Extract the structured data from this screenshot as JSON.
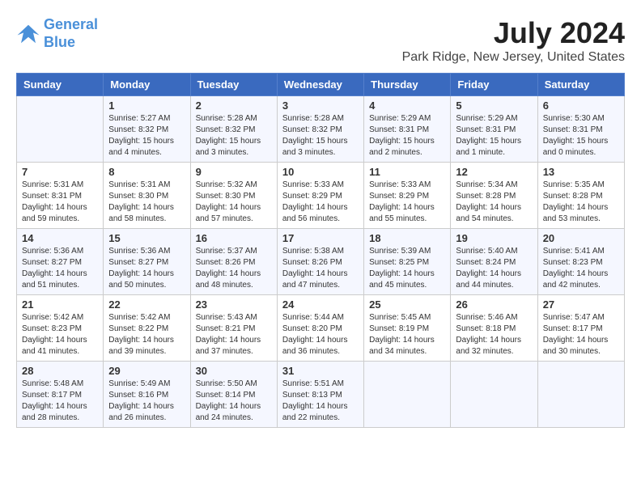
{
  "header": {
    "logo_line1": "General",
    "logo_line2": "Blue",
    "month_year": "July 2024",
    "location": "Park Ridge, New Jersey, United States"
  },
  "days_of_week": [
    "Sunday",
    "Monday",
    "Tuesday",
    "Wednesday",
    "Thursday",
    "Friday",
    "Saturday"
  ],
  "weeks": [
    [
      {
        "day": "",
        "sunrise": "",
        "sunset": "",
        "daylight": ""
      },
      {
        "day": "1",
        "sunrise": "Sunrise: 5:27 AM",
        "sunset": "Sunset: 8:32 PM",
        "daylight": "Daylight: 15 hours and 4 minutes."
      },
      {
        "day": "2",
        "sunrise": "Sunrise: 5:28 AM",
        "sunset": "Sunset: 8:32 PM",
        "daylight": "Daylight: 15 hours and 3 minutes."
      },
      {
        "day": "3",
        "sunrise": "Sunrise: 5:28 AM",
        "sunset": "Sunset: 8:32 PM",
        "daylight": "Daylight: 15 hours and 3 minutes."
      },
      {
        "day": "4",
        "sunrise": "Sunrise: 5:29 AM",
        "sunset": "Sunset: 8:31 PM",
        "daylight": "Daylight: 15 hours and 2 minutes."
      },
      {
        "day": "5",
        "sunrise": "Sunrise: 5:29 AM",
        "sunset": "Sunset: 8:31 PM",
        "daylight": "Daylight: 15 hours and 1 minute."
      },
      {
        "day": "6",
        "sunrise": "Sunrise: 5:30 AM",
        "sunset": "Sunset: 8:31 PM",
        "daylight": "Daylight: 15 hours and 0 minutes."
      }
    ],
    [
      {
        "day": "7",
        "sunrise": "Sunrise: 5:31 AM",
        "sunset": "Sunset: 8:31 PM",
        "daylight": "Daylight: 14 hours and 59 minutes."
      },
      {
        "day": "8",
        "sunrise": "Sunrise: 5:31 AM",
        "sunset": "Sunset: 8:30 PM",
        "daylight": "Daylight: 14 hours and 58 minutes."
      },
      {
        "day": "9",
        "sunrise": "Sunrise: 5:32 AM",
        "sunset": "Sunset: 8:30 PM",
        "daylight": "Daylight: 14 hours and 57 minutes."
      },
      {
        "day": "10",
        "sunrise": "Sunrise: 5:33 AM",
        "sunset": "Sunset: 8:29 PM",
        "daylight": "Daylight: 14 hours and 56 minutes."
      },
      {
        "day": "11",
        "sunrise": "Sunrise: 5:33 AM",
        "sunset": "Sunset: 8:29 PM",
        "daylight": "Daylight: 14 hours and 55 minutes."
      },
      {
        "day": "12",
        "sunrise": "Sunrise: 5:34 AM",
        "sunset": "Sunset: 8:28 PM",
        "daylight": "Daylight: 14 hours and 54 minutes."
      },
      {
        "day": "13",
        "sunrise": "Sunrise: 5:35 AM",
        "sunset": "Sunset: 8:28 PM",
        "daylight": "Daylight: 14 hours and 53 minutes."
      }
    ],
    [
      {
        "day": "14",
        "sunrise": "Sunrise: 5:36 AM",
        "sunset": "Sunset: 8:27 PM",
        "daylight": "Daylight: 14 hours and 51 minutes."
      },
      {
        "day": "15",
        "sunrise": "Sunrise: 5:36 AM",
        "sunset": "Sunset: 8:27 PM",
        "daylight": "Daylight: 14 hours and 50 minutes."
      },
      {
        "day": "16",
        "sunrise": "Sunrise: 5:37 AM",
        "sunset": "Sunset: 8:26 PM",
        "daylight": "Daylight: 14 hours and 48 minutes."
      },
      {
        "day": "17",
        "sunrise": "Sunrise: 5:38 AM",
        "sunset": "Sunset: 8:26 PM",
        "daylight": "Daylight: 14 hours and 47 minutes."
      },
      {
        "day": "18",
        "sunrise": "Sunrise: 5:39 AM",
        "sunset": "Sunset: 8:25 PM",
        "daylight": "Daylight: 14 hours and 45 minutes."
      },
      {
        "day": "19",
        "sunrise": "Sunrise: 5:40 AM",
        "sunset": "Sunset: 8:24 PM",
        "daylight": "Daylight: 14 hours and 44 minutes."
      },
      {
        "day": "20",
        "sunrise": "Sunrise: 5:41 AM",
        "sunset": "Sunset: 8:23 PM",
        "daylight": "Daylight: 14 hours and 42 minutes."
      }
    ],
    [
      {
        "day": "21",
        "sunrise": "Sunrise: 5:42 AM",
        "sunset": "Sunset: 8:23 PM",
        "daylight": "Daylight: 14 hours and 41 minutes."
      },
      {
        "day": "22",
        "sunrise": "Sunrise: 5:42 AM",
        "sunset": "Sunset: 8:22 PM",
        "daylight": "Daylight: 14 hours and 39 minutes."
      },
      {
        "day": "23",
        "sunrise": "Sunrise: 5:43 AM",
        "sunset": "Sunset: 8:21 PM",
        "daylight": "Daylight: 14 hours and 37 minutes."
      },
      {
        "day": "24",
        "sunrise": "Sunrise: 5:44 AM",
        "sunset": "Sunset: 8:20 PM",
        "daylight": "Daylight: 14 hours and 36 minutes."
      },
      {
        "day": "25",
        "sunrise": "Sunrise: 5:45 AM",
        "sunset": "Sunset: 8:19 PM",
        "daylight": "Daylight: 14 hours and 34 minutes."
      },
      {
        "day": "26",
        "sunrise": "Sunrise: 5:46 AM",
        "sunset": "Sunset: 8:18 PM",
        "daylight": "Daylight: 14 hours and 32 minutes."
      },
      {
        "day": "27",
        "sunrise": "Sunrise: 5:47 AM",
        "sunset": "Sunset: 8:17 PM",
        "daylight": "Daylight: 14 hours and 30 minutes."
      }
    ],
    [
      {
        "day": "28",
        "sunrise": "Sunrise: 5:48 AM",
        "sunset": "Sunset: 8:17 PM",
        "daylight": "Daylight: 14 hours and 28 minutes."
      },
      {
        "day": "29",
        "sunrise": "Sunrise: 5:49 AM",
        "sunset": "Sunset: 8:16 PM",
        "daylight": "Daylight: 14 hours and 26 minutes."
      },
      {
        "day": "30",
        "sunrise": "Sunrise: 5:50 AM",
        "sunset": "Sunset: 8:14 PM",
        "daylight": "Daylight: 14 hours and 24 minutes."
      },
      {
        "day": "31",
        "sunrise": "Sunrise: 5:51 AM",
        "sunset": "Sunset: 8:13 PM",
        "daylight": "Daylight: 14 hours and 22 minutes."
      },
      {
        "day": "",
        "sunrise": "",
        "sunset": "",
        "daylight": ""
      },
      {
        "day": "",
        "sunrise": "",
        "sunset": "",
        "daylight": ""
      },
      {
        "day": "",
        "sunrise": "",
        "sunset": "",
        "daylight": ""
      }
    ]
  ]
}
